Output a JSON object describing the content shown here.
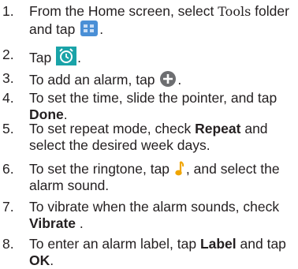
{
  "steps": [
    {
      "num": "1.",
      "parts": [
        {
          "text": "From the Home screen, select "
        },
        {
          "text": "Tools",
          "style": "mono"
        },
        {
          "text": " folder and tap "
        },
        {
          "icon": "tools-folder-icon"
        },
        {
          "text": "."
        }
      ]
    },
    {
      "num": "2.",
      "parts": [
        {
          "text": "Tap "
        },
        {
          "icon": "alarm-clock-icon"
        },
        {
          "text": "."
        }
      ]
    },
    {
      "num": "3.",
      "parts": [
        {
          "text": "To add an alarm, tap "
        },
        {
          "icon": "add-icon"
        },
        {
          "text": "."
        }
      ]
    },
    {
      "num": "4.",
      "parts": [
        {
          "text": "To set the time, slide the pointer, and tap "
        },
        {
          "text": "Done",
          "style": "bold"
        },
        {
          "text": "."
        }
      ]
    },
    {
      "num": "5.",
      "parts": [
        {
          "text": "To set repeat mode, check "
        },
        {
          "text": "Repeat",
          "style": "bold"
        },
        {
          "text": " and select the desired week days."
        }
      ]
    },
    {
      "num": "6.",
      "parts": [
        {
          "text": "To set the ringtone, tap "
        },
        {
          "icon": "music-note-icon"
        },
        {
          "text": ", and select the alarm sound."
        }
      ]
    },
    {
      "num": "7.",
      "parts": [
        {
          "text": "To vibrate when the alarm sounds, check "
        },
        {
          "text": "Vibrate",
          "style": "bold"
        },
        {
          "text": "  ."
        }
      ]
    },
    {
      "num": "8.",
      "parts": [
        {
          "text": "To enter an alarm label, tap "
        },
        {
          "text": "Label",
          "style": "bold"
        },
        {
          "text": " and tap "
        },
        {
          "text": "OK",
          "style": "bold"
        },
        {
          "text": "."
        }
      ]
    }
  ],
  "colors": {
    "text": "#231f20",
    "folder_icon": "#4a8fd6",
    "alarm_icon": "#1aa3a8",
    "add_icon": "#6d6e71",
    "note_icon": "#f0a500"
  }
}
